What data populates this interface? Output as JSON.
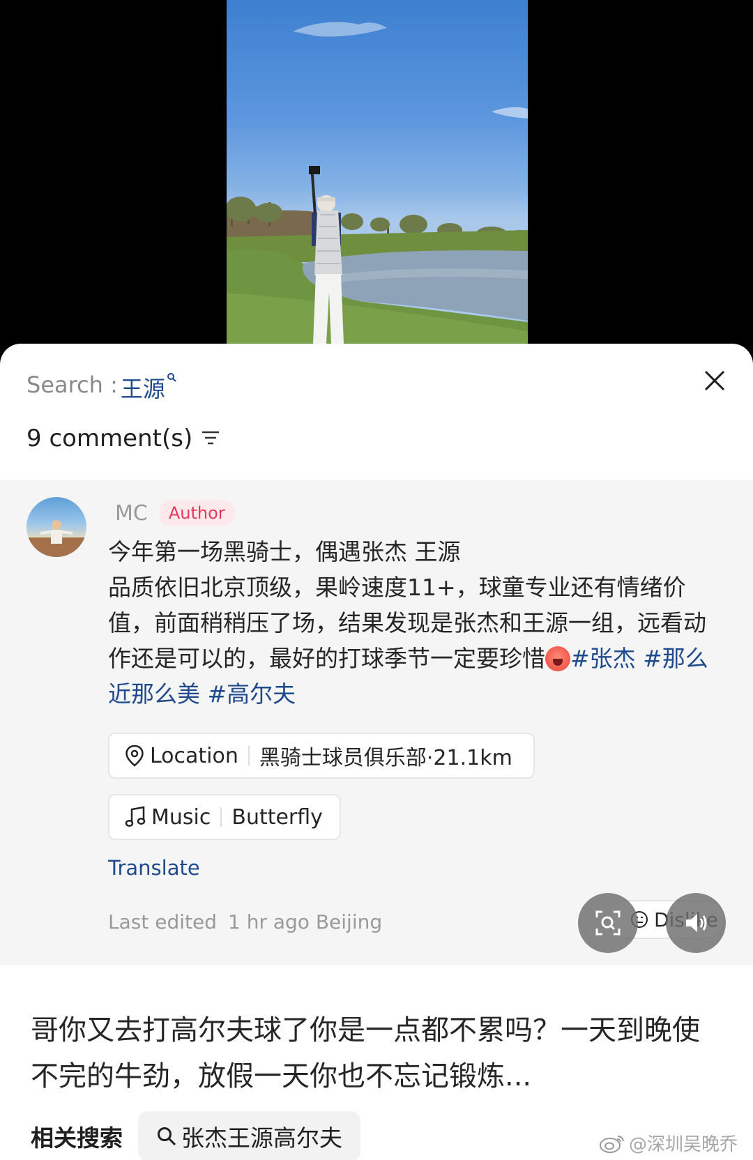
{
  "search": {
    "prefix": "Search : ",
    "keyword": "王源",
    "keyword_icon": "small-search-icon"
  },
  "comments_header": {
    "count_text": "9 comment(s)",
    "sort_icon": "sort-lines-icon"
  },
  "post": {
    "username": "MC",
    "badge": "Author",
    "text_line1": "今年第一场黑骑士，偶遇张杰 王源",
    "text_body": "品质依旧北京顶级，果岭速度11+，球童专业还有情绪价值，前面稍稍压了场，结果发现是张杰和王源一组，远看动作还是可以的，最好的打球季节一定要珍惜",
    "hashtags": [
      "#张杰",
      "#那么近那么美",
      "#高尔夫"
    ],
    "location": {
      "label": "Location",
      "value": "黑骑士球员俱乐部·21.1km",
      "icon": "location-pin-icon"
    },
    "music": {
      "label": "Music",
      "value": "Butterfly",
      "icon": "music-note-icon"
    },
    "translate": "Translate",
    "last_edited_label": "Last edited",
    "last_edited_value": "1 hr ago Beijing",
    "dislike": "Dislike"
  },
  "comment2": {
    "text": "哥你又去打高尔夫球了你是一点都不累吗？一天到晚使不完的牛劲，放假一天你也不忘记锻炼..."
  },
  "related": {
    "label": "相关搜索",
    "query": "张杰王源高尔夫"
  },
  "watermark": {
    "text": "@深圳吴晚乔"
  },
  "colors": {
    "link": "#1f4a8e",
    "badge_text": "#e8385a",
    "badge_bg": "#fde8ec",
    "panel_bg": "#f5f5f5"
  }
}
